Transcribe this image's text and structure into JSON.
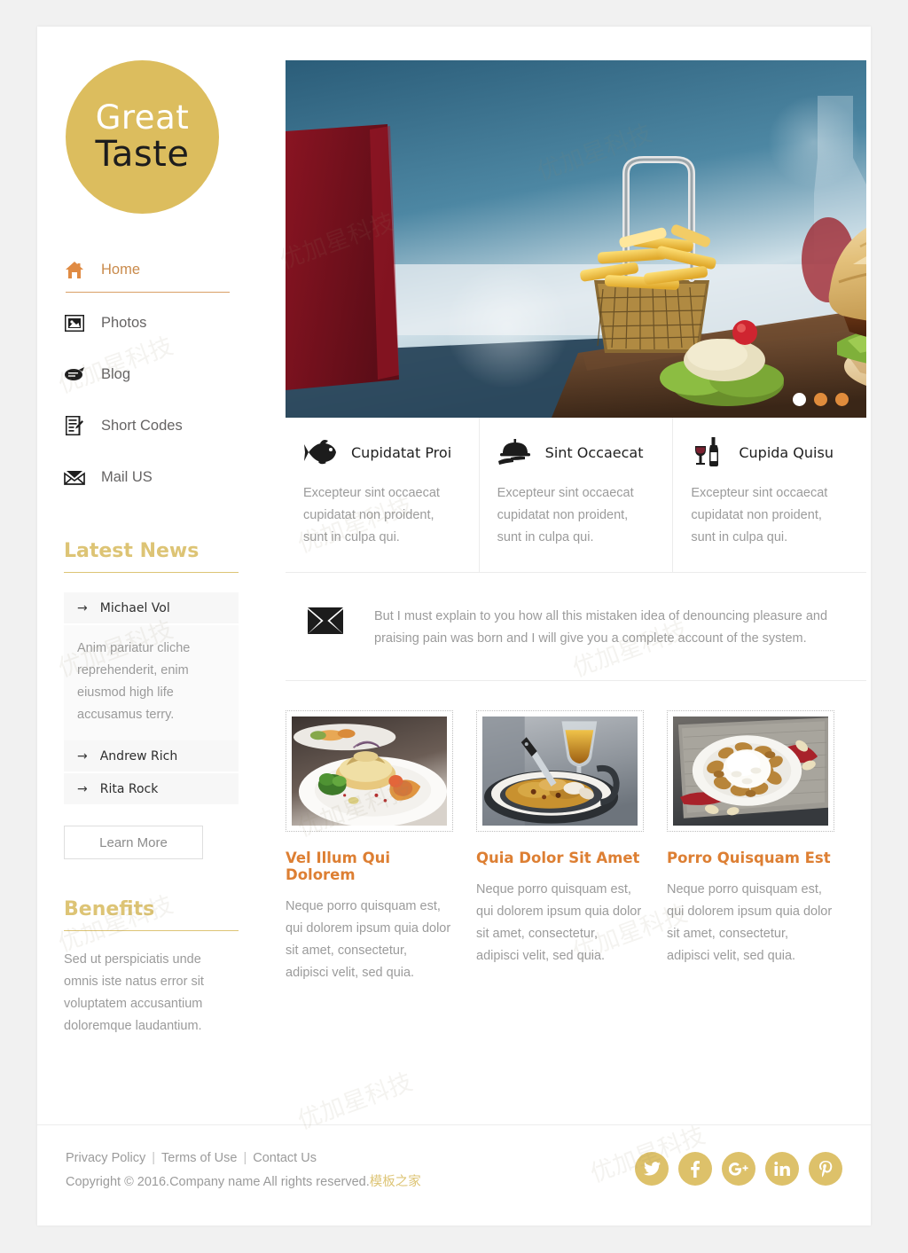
{
  "site": {
    "logo_top": "Great",
    "logo_bottom": "Taste",
    "brand_gold": "#dcbd5e",
    "accent_orange": "#dd7f33"
  },
  "nav": {
    "items": [
      {
        "label": "Home",
        "icon": "home-icon",
        "active": true
      },
      {
        "label": "Photos",
        "icon": "photo-icon",
        "active": false
      },
      {
        "label": "Blog",
        "icon": "blog-icon",
        "active": false
      },
      {
        "label": "Short Codes",
        "icon": "shortcodes-icon",
        "active": false
      },
      {
        "label": "Mail US",
        "icon": "mail-icon",
        "active": false
      }
    ]
  },
  "latest_news": {
    "heading": "Latest News",
    "items": [
      {
        "name": "Michael Vol",
        "arrow": "→"
      },
      {
        "name": "Andrew Rich",
        "arrow": "→"
      },
      {
        "name": "Rita Rock",
        "arrow": "→"
      }
    ],
    "description": "Anim pariatur cliche reprehenderit, enim eiusmod high life accusamus terry.",
    "button_label": "Learn More"
  },
  "benefits": {
    "heading": "Benefits",
    "text": "Sed ut perspiciatis unde omnis iste natus error sit voluptatem accusantium doloremque laudantium."
  },
  "slider": {
    "dots": [
      {
        "active": true
      },
      {
        "active": false
      },
      {
        "active": false
      }
    ]
  },
  "features": [
    {
      "icon": "fish-icon",
      "title": "Cupidatat Proi",
      "text": "Excepteur sint occaecat cupidatat non proident, sunt in culpa qui."
    },
    {
      "icon": "serving-tray-icon",
      "title": "Sint Occaecat",
      "text": "Excepteur sint occaecat cupidatat non proident, sunt in culpa qui."
    },
    {
      "icon": "wine-bottle-icon",
      "title": "Cupida Quisu",
      "text": "Excepteur sint occaecat cupidatat non proident, sunt in culpa qui."
    }
  ],
  "newsletter": {
    "icon": "envelope-icon",
    "text": "But I must explain to you how all this mistaken idea of denouncing pleasure and praising pain was born and I will give you a complete account of the system."
  },
  "cards": [
    {
      "title": "Vel Illum Qui Dolorem",
      "text": "Neque porro quisquam est, qui dolorem ipsum quia dolor sit amet, consectetur, adipisci velit, sed quia."
    },
    {
      "title": "Quia Dolor Sit Amet",
      "text": "Neque porro quisquam est, qui dolorem ipsum quia dolor sit amet, consectetur, adipisci velit, sed quia."
    },
    {
      "title": "Porro Quisquam Est",
      "text": "Neque porro quisquam est, qui dolorem ipsum quia dolor sit amet, consectetur, adipisci velit, sed quia."
    }
  ],
  "footer": {
    "links": [
      "Privacy Policy",
      "Terms of Use",
      "Contact Us"
    ],
    "separator": "|",
    "copyright": "Copyright © 2016.Company name All rights reserved.",
    "template_credit": "模板之家",
    "socials": [
      {
        "name": "twitter-icon",
        "glyph": "t"
      },
      {
        "name": "facebook-icon",
        "glyph": "f"
      },
      {
        "name": "google-plus-icon",
        "glyph": "g+"
      },
      {
        "name": "linkedin-icon",
        "glyph": "in"
      },
      {
        "name": "pinterest-icon",
        "glyph": "p"
      }
    ]
  },
  "watermarks": [
    "优加星科技",
    "模板之家"
  ]
}
